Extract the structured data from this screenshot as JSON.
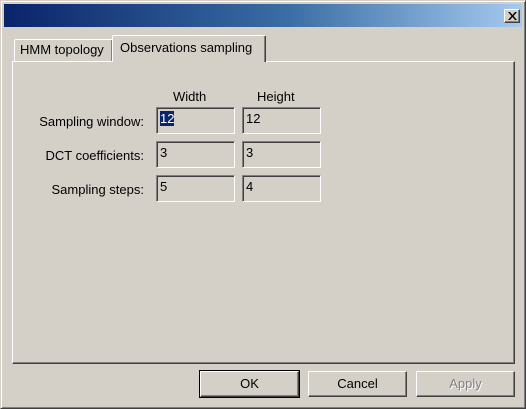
{
  "dialog": {
    "title": "",
    "close_icon": "close-x-icon"
  },
  "tabs": [
    {
      "label": "HMM topology",
      "active": false
    },
    {
      "label": "Observations sampling",
      "active": true
    }
  ],
  "grid": {
    "columns": [
      "Width",
      "Height"
    ],
    "rows": [
      {
        "label": "Sampling window:",
        "width": "12",
        "height": "12"
      },
      {
        "label": "DCT coefficients:",
        "width": "3",
        "height": "3"
      },
      {
        "label": "Sampling steps:",
        "width": "5",
        "height": "4"
      }
    ]
  },
  "buttons": {
    "ok": "OK",
    "cancel": "Cancel",
    "apply": "Apply"
  },
  "colors": {
    "face": "#d4d0c8",
    "title_start": "#0a246a",
    "title_end": "#a6caf0",
    "selection": "#0a246a"
  }
}
